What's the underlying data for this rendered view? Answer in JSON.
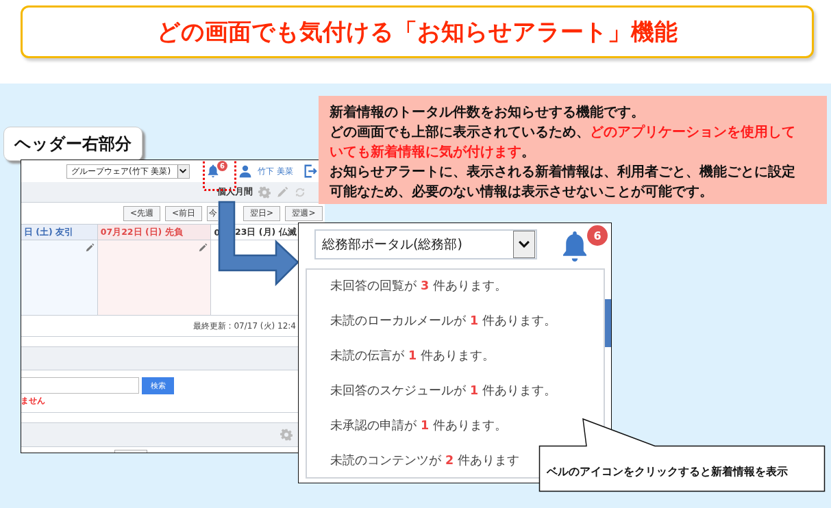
{
  "title": "どの画面でも気付ける「お知らせアラート」機能",
  "section_label": "ヘッダー右部分",
  "header_screen": {
    "portal_select": "グループウェア(竹下 美菜)",
    "notification_count": "6",
    "user_name": "竹下 美菜",
    "calendar_title": "個人月間",
    "nav_buttons": [
      "<先週",
      "<前日",
      "今",
      "翌日>",
      "翌週>"
    ],
    "day_columns": [
      {
        "label": "日 (土) 友引",
        "kind": "saturday"
      },
      {
        "label": "07月22日 (日) 先負",
        "kind": "sunday"
      },
      {
        "label": "0",
        "label_after": "23日 (月) 仏滅",
        "kind": "weekday"
      }
    ],
    "last_updated": "最終更新 : 07/17 (火) 12:4",
    "search_button": "検索",
    "error_text": "ません"
  },
  "note": {
    "line_1": "新着情報のトータル件数をお知らせする機能です。",
    "before": "どの画面でも上部に表示されているため、",
    "highlight": "どのアプリケーションを使用していても新着情報に気が付けます",
    "after": "。",
    "line_3": "お知らせアラートに、表示される新着情報は、利用者ごと、機能ごとに設定可能なため、必要のない情報は表示させないことが可能です。"
  },
  "dropdown_screen": {
    "portal_select": "総務部ポータル(総務部)",
    "notification_count": "6",
    "notifications": [
      {
        "before": "未回答の回覧が",
        "count": "3",
        "after": "件あります。"
      },
      {
        "before": "未読のローカルメールが",
        "count": "1",
        "after": "件あります。"
      },
      {
        "before": "未読の伝言が",
        "count": "1",
        "after": "件あります。"
      },
      {
        "before": "未回答のスケジュールが",
        "count": "1",
        "after": "件あります。"
      },
      {
        "before": "未承認の申請が",
        "count": "1",
        "after": "件あります。"
      },
      {
        "before": "未読のコンテンツが",
        "count": "2",
        "after": "件あります"
      }
    ]
  },
  "callout": "ベルのアイコンをクリックすると新着情報を表示"
}
